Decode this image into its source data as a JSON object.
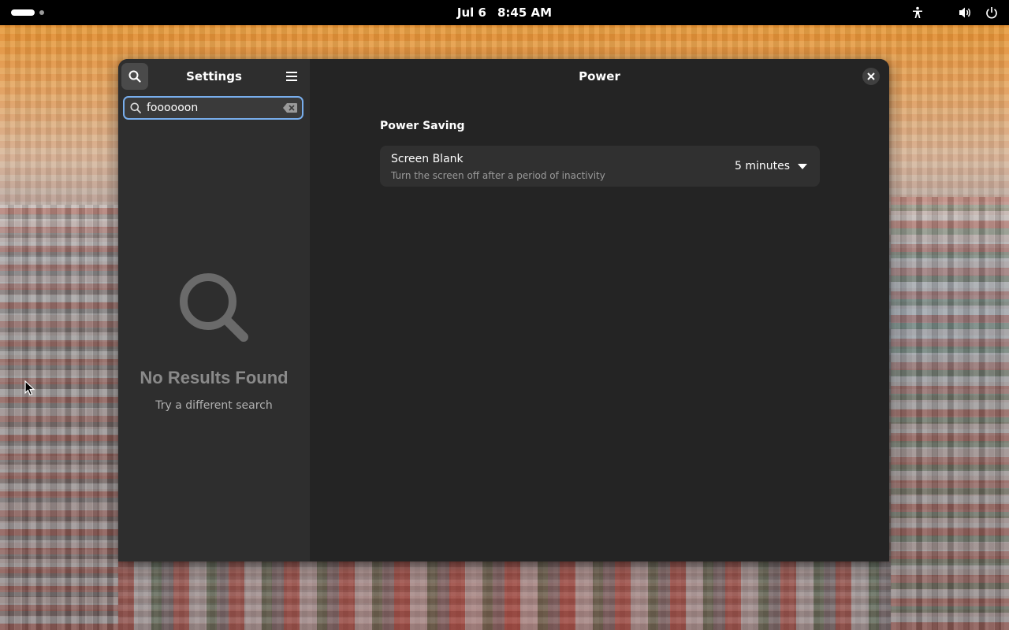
{
  "topbar": {
    "date": "Jul 6",
    "time": "8:45 AM",
    "icons": [
      "workspace-indicator-icon",
      "accessibility-icon",
      "volume-icon",
      "power-icon"
    ]
  },
  "window": {
    "sidebar": {
      "title": "Settings",
      "search": {
        "value": "foooooon",
        "placeholder": ""
      },
      "empty_state": {
        "title": "No Results Found",
        "subtitle": "Try a different search"
      }
    },
    "content": {
      "title": "Power",
      "group_title": "Power Saving",
      "screen_blank": {
        "title": "Screen Blank",
        "subtitle": "Turn the screen off after a period of inactivity",
        "value": "5 minutes"
      }
    }
  },
  "colors": {
    "accent_focus": "#78aeed",
    "sidebar_bg": "#2e2e2e",
    "content_bg": "#242424",
    "row_bg": "#303030"
  }
}
